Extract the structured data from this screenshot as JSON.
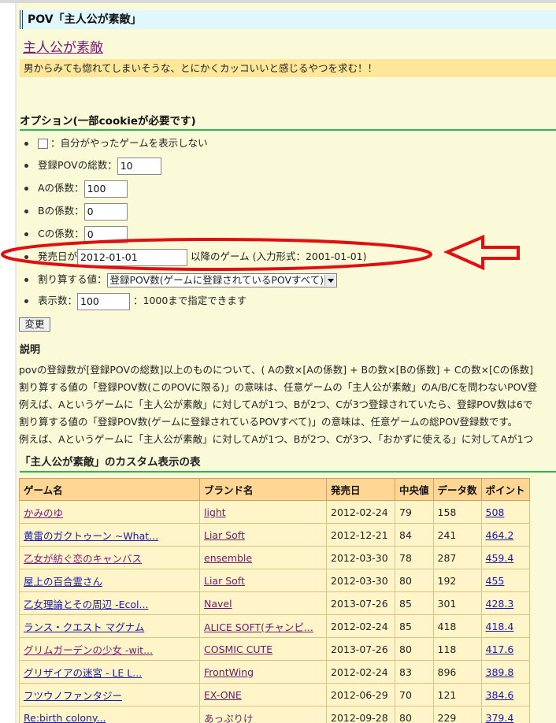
{
  "title_bar": "POV「主人公が素敵」",
  "pov_link": "主人公が素敵",
  "pov_description": "男からみても惚れてしまいそうな、とにかくカッコいいと感じるやつを求む！！",
  "options": {
    "heading": "オプション(一部cookieが必要です)",
    "hide_played_label": "：自分がやったゲームを表示しない",
    "hide_played_checked": false,
    "total_pov_label": "登録POVの総数：",
    "total_pov_value": "10",
    "a_coef_label": "Aの係数：",
    "a_coef_value": "100",
    "b_coef_label": "Bの係数：",
    "b_coef_value": "0",
    "c_coef_label": "Cの係数：",
    "c_coef_value": "0",
    "release_label": "発売日が",
    "release_value": "2012-01-01",
    "release_suffix": "以降のゲーム (入力形式：2001-01-01)",
    "divisor_label": "割り算する値：",
    "divisor_selected": "登録POV数(ゲームに登録されているPOVすべて)",
    "display_count_label": "表示数：",
    "display_count_value": "100",
    "display_count_note": "：1000まで指定できます",
    "change_button": "変更"
  },
  "explanation": {
    "heading": "説明",
    "lines": [
      "povの登録数が[登録POVの総数]以上のものについて、( Aの数×[Aの係数] + Bの数×[Bの係数] + Cの数×[Cの係数]",
      "割り算する値の「登録POV数(このPOVに限る)」の意味は、任意ゲームの「主人公が素敵」のA/B/Cを問わないPOV登",
      "例えば、Aというゲームに「主人公が素敵」に対してAが1つ、Bが2つ、Cが3つ登録されていたら、登録POV数は6で",
      "割り算する値の「登録POV数(ゲームに登録されているPOVすべて)」の意味は、任意ゲームの総POV登録数です。",
      "例えば、Aというゲームに「主人公が素敵」に対してAが1つ、Bが2つ、Cが3つ、「おかずに使える」に対してAが1つ"
    ]
  },
  "table": {
    "heading": "「主人公が素敵」のカスタム表示の表",
    "columns": [
      "ゲーム名",
      "ブランド名",
      "発売日",
      "中央値",
      "データ数",
      "ポイント"
    ],
    "rows": [
      {
        "game": "かみのゆ",
        "brand": "light",
        "date": "2012-02-24",
        "median": "79",
        "count": "158",
        "points": "508"
      },
      {
        "game": "黄雷のガクトゥーン ~What...",
        "brand": "Liar Soft",
        "date": "2012-12-21",
        "median": "84",
        "count": "241",
        "points": "464.2"
      },
      {
        "game": "乙女が紡ぐ恋のキャンバス",
        "brand": "ensemble",
        "date": "2012-03-30",
        "median": "78",
        "count": "287",
        "points": "459.4"
      },
      {
        "game": "屋上の百合霊さん",
        "brand": "Liar Soft",
        "date": "2012-03-30",
        "median": "80",
        "count": "192",
        "points": "455"
      },
      {
        "game": "乙女理論とその周辺 -Ecol...",
        "brand": "Navel",
        "date": "2013-07-26",
        "median": "85",
        "count": "301",
        "points": "428.3"
      },
      {
        "game": "ランス・クエスト マグナム",
        "brand": "ALICE SOFT(チャンピ...",
        "date": "2012-02-24",
        "median": "85",
        "count": "418",
        "points": "418.4"
      },
      {
        "game": "グリムガーデンの少女 -wit...",
        "brand": "COSMIC CUTE",
        "date": "2013-07-26",
        "median": "80",
        "count": "118",
        "points": "417.6"
      },
      {
        "game": "グリザイアの迷宮 - LE L...",
        "brand": "FrontWing",
        "date": "2012-02-24",
        "median": "83",
        "count": "896",
        "points": "389.8"
      },
      {
        "game": "フツウノファンタジー",
        "brand": "EX-ONE",
        "date": "2012-06-29",
        "median": "70",
        "count": "121",
        "points": "384.6"
      },
      {
        "game": "Re:birth colony...",
        "brand": "あっぷりけ",
        "date": "2012-09-28",
        "median": "80",
        "count": "229",
        "points": "379.4"
      }
    ]
  },
  "colors": {
    "annotation": "#e01010",
    "header_bg": "#ffd693",
    "link": "#1a1aa8",
    "visited": "#7a1a7a",
    "accent_line": "#2db84d"
  },
  "icons": {
    "annotation_arrow": "left-arrow-icon"
  }
}
